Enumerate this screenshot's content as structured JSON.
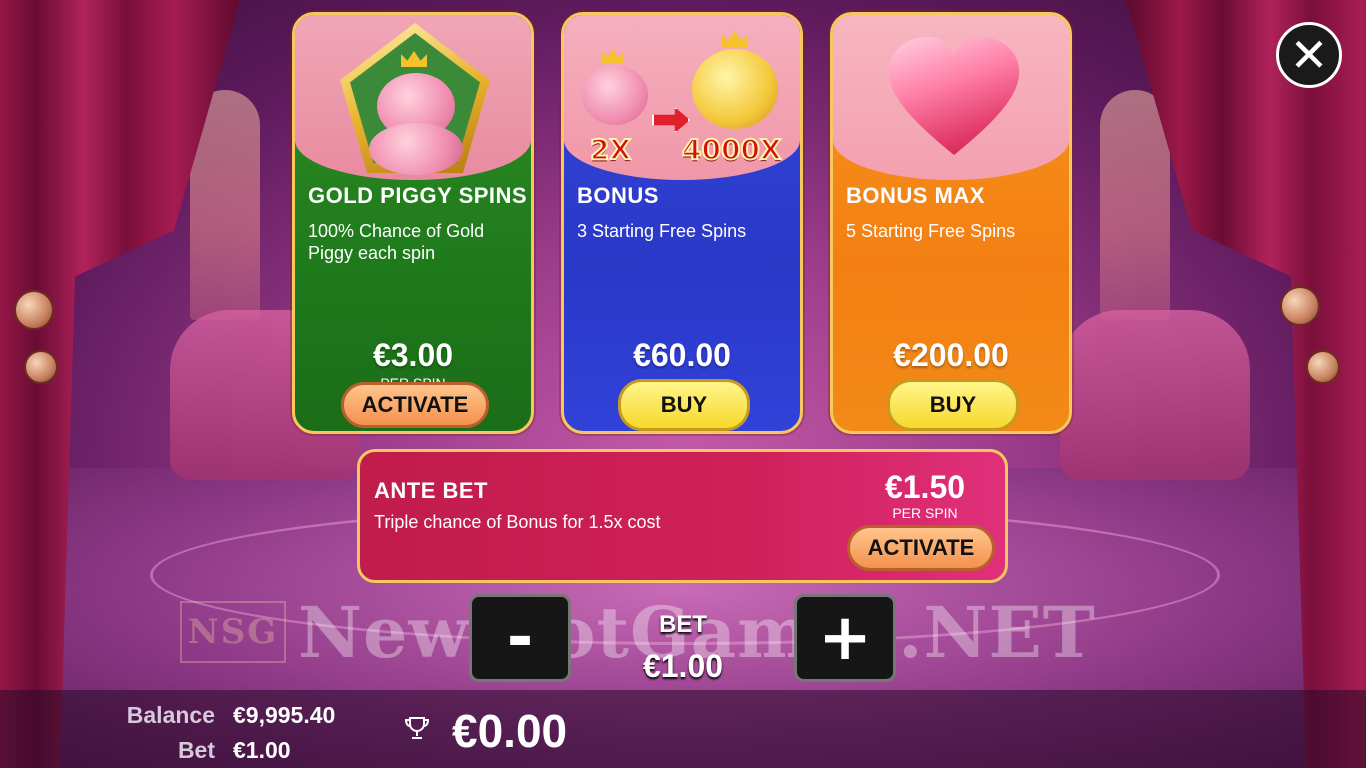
{
  "close": {
    "icon": "close-icon"
  },
  "cards": [
    {
      "title": "GOLD PIGGY SPINS",
      "description": "100% Chance of Gold Piggy each spin",
      "price": "€3.00",
      "per_label": "PER SPIN",
      "button": "ACTIVATE",
      "color": "#2a8a22"
    },
    {
      "title": "BONUS",
      "description": "3 Starting Free Spins",
      "price": "€60.00",
      "button": "BUY",
      "multiplier_from": "2X",
      "multiplier_to": "4000X",
      "color": "#3344d6"
    },
    {
      "title": "BONUS MAX",
      "description": "5 Starting Free Spins",
      "price": "€200.00",
      "button": "BUY",
      "color": "#f48a16"
    }
  ],
  "ante_bet": {
    "title": "ANTE BET",
    "description": "Triple chance of Bonus for 1.5x cost",
    "price": "€1.50",
    "per_label": "PER SPIN",
    "button": "ACTIVATE",
    "color": "#cc1f55"
  },
  "bet_control": {
    "minus": "-",
    "plus": "+",
    "label": "BET",
    "value": "€1.00"
  },
  "watermark": {
    "logo": "NSG",
    "text": "NewSlotGames.NET"
  },
  "status": {
    "balance_label": "Balance",
    "balance_value": "€9,995.40",
    "bet_label": "Bet",
    "bet_value": "€1.00",
    "win_value": "€0.00",
    "win_icon": "trophy-icon"
  }
}
